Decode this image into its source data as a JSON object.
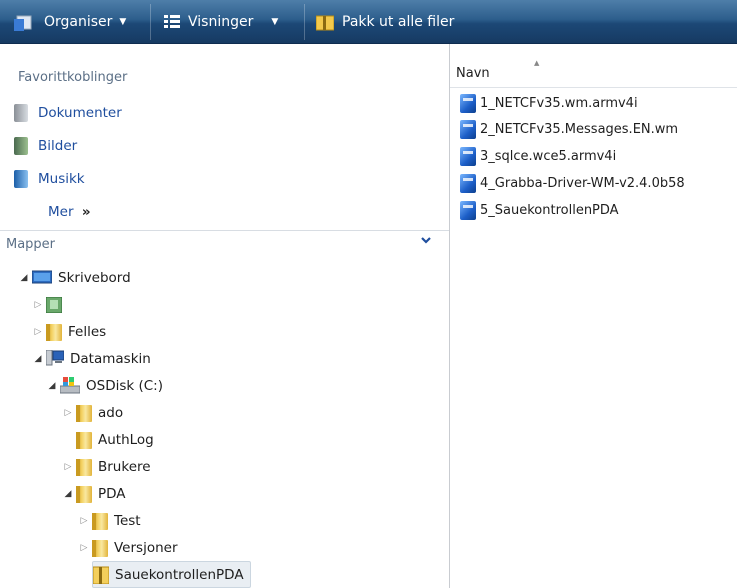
{
  "toolbar": {
    "organize": "Organiser",
    "views": "Visninger",
    "extract": "Pakk ut alle filer"
  },
  "favorites": {
    "title": "Favorittkoblinger",
    "items": [
      "Dokumenter",
      "Bilder",
      "Musikk"
    ],
    "more": "Mer",
    "more_glyph": "»"
  },
  "folders": {
    "title": "Mapper",
    "tree": [
      {
        "label": "Skrivebord",
        "level": 0,
        "toggle": "open",
        "icon": "desktop-icon"
      },
      {
        "label": "",
        "level": 1,
        "toggle": "closed",
        "icon": "user-folder-icon"
      },
      {
        "label": "Felles",
        "level": 1,
        "toggle": "closed",
        "icon": "folder-icon"
      },
      {
        "label": "Datamaskin",
        "level": 1,
        "toggle": "open",
        "icon": "computer-icon"
      },
      {
        "label": "OSDisk (C:)",
        "level": 2,
        "toggle": "open",
        "icon": "drive-icon"
      },
      {
        "label": "ado",
        "level": 3,
        "toggle": "closed",
        "icon": "folder-icon"
      },
      {
        "label": "AuthLog",
        "level": 3,
        "toggle": "none",
        "icon": "folder-icon"
      },
      {
        "label": "Brukere",
        "level": 3,
        "toggle": "closed",
        "icon": "folder-icon"
      },
      {
        "label": "PDA",
        "level": 3,
        "toggle": "open",
        "icon": "folder-icon"
      },
      {
        "label": "Test",
        "level": 4,
        "toggle": "closed",
        "icon": "folder-icon"
      },
      {
        "label": "Versjoner",
        "level": 4,
        "toggle": "closed",
        "icon": "folder-icon"
      },
      {
        "label": "SauekontrollenPDA",
        "level": 4,
        "toggle": "none",
        "icon": "zip-folder-icon",
        "selected": true
      }
    ]
  },
  "filelist": {
    "column": "Navn",
    "files": [
      "1_NETCFv35.wm.armv4i",
      "2_NETCFv35.Messages.EN.wm",
      "3_sqlce.wce5.armv4i",
      "4_Grabba-Driver-WM-v2.4.0b58",
      "5_SauekontrollenPDA"
    ]
  },
  "colors": {
    "toolbar": "#1c4876",
    "link": "#1f4e9e",
    "section": "#5b6f86"
  }
}
